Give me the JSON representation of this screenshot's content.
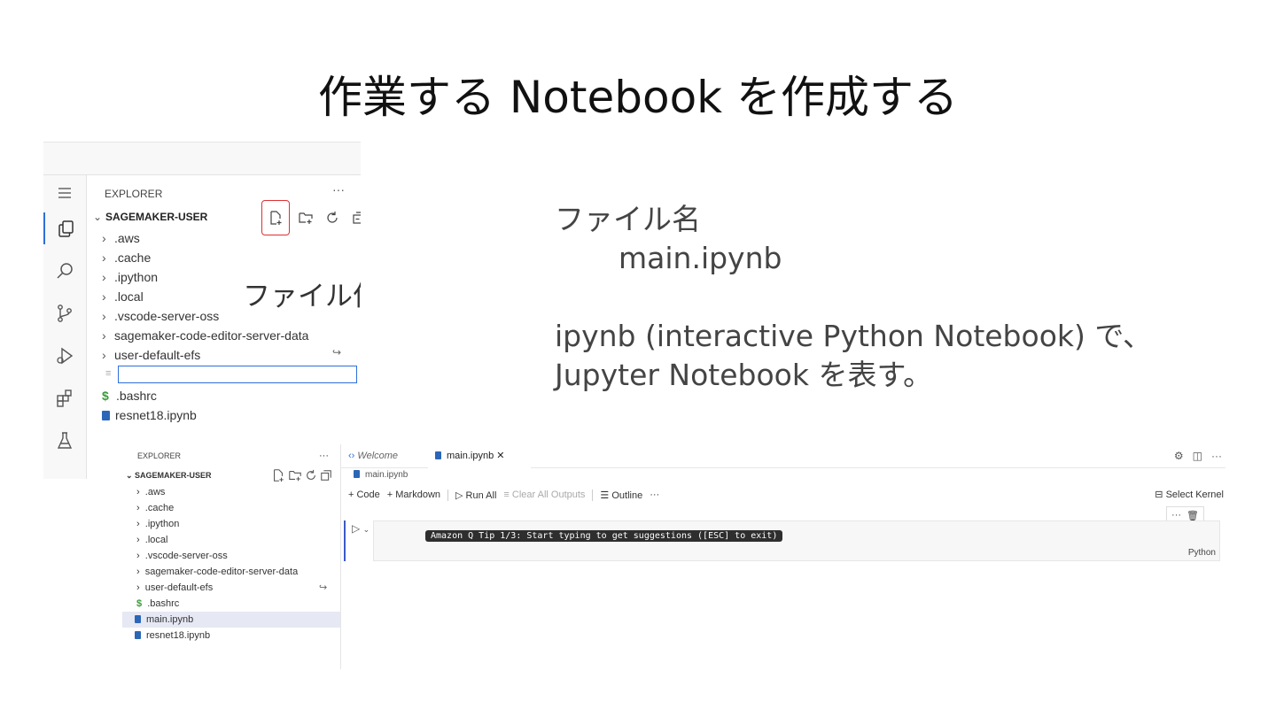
{
  "title": "作業する Notebook を作成する",
  "notes": {
    "filename_label": "ファイル名",
    "filename_value": "main.ipynb",
    "desc_line1": "ipynb (interactive Python Notebook) で、",
    "desc_line2": "Jupyter Notebook を表す。"
  },
  "annotation": "ファイル作成",
  "explorer1": {
    "header": "EXPLORER",
    "more": "···",
    "root": "SAGEMAKER-USER",
    "folders": [
      ".aws",
      ".cache",
      ".ipython",
      ".local",
      ".vscode-server-oss",
      "sagemaker-code-editor-server-data",
      "user-default-efs"
    ],
    "files": [
      ".bashrc",
      "resnet18.ipynb"
    ]
  },
  "explorer2": {
    "header": "EXPLORER",
    "more": "···",
    "root": "SAGEMAKER-USER",
    "folders": [
      ".aws",
      ".cache",
      ".ipython",
      ".local",
      ".vscode-server-oss",
      "sagemaker-code-editor-server-data",
      "user-default-efs"
    ],
    "files": [
      ".bashrc",
      "main.ipynb",
      "resnet18.ipynb"
    ]
  },
  "editor": {
    "tab_welcome": "Welcome",
    "tab_main": "main.ipynb",
    "breadcrumb": "main.ipynb",
    "toolbar": {
      "code": "Code",
      "markdown": "Markdown",
      "run_all": "Run All",
      "clear_outputs": "Clear All Outputs",
      "outline": "Outline",
      "more": "···"
    },
    "select_kernel": "Select Kernel",
    "cell_tip": "Amazon Q Tip 1/3: Start typing to get suggestions ([ESC] to exit)",
    "cell_language": "Python",
    "cell_more": "···"
  },
  "colors": {
    "accent": "#2d6fd8",
    "highlight_border": "#e03030",
    "notebook_icon": "#2b66b8"
  }
}
